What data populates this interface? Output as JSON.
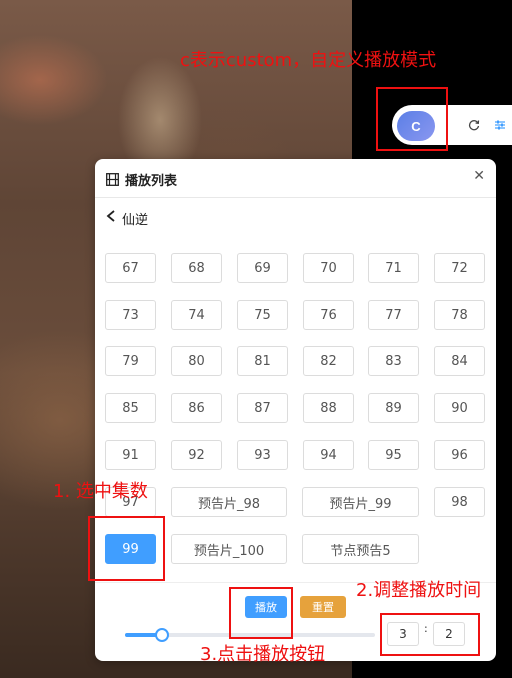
{
  "panel": {
    "title": "播放列表",
    "series_name": "仙逆",
    "episodes_row1": [
      "67",
      "68",
      "69",
      "70",
      "71",
      "72"
    ],
    "episodes_row2": [
      "73",
      "74",
      "75",
      "76",
      "77",
      "78"
    ],
    "episodes_row3": [
      "79",
      "80",
      "81",
      "82",
      "83",
      "84"
    ],
    "episodes_row4": [
      "85",
      "86",
      "87",
      "88",
      "89",
      "90"
    ],
    "episodes_row5": [
      "91",
      "92",
      "93",
      "94",
      "95",
      "96"
    ],
    "episodes_row6": [
      "97",
      "预告片_98",
      "预告片_99",
      "98"
    ],
    "episodes_row7": [
      "99",
      "预告片_100",
      "节点预告5"
    ],
    "selected_episode": "99",
    "play_label": "播放",
    "reset_label": "重置",
    "time_minutes": "3",
    "time_seconds": "2",
    "time_separator": ":",
    "slider_fraction": 0.14
  },
  "toolbar": {
    "mode_label": "C"
  },
  "icons": {
    "close": "close-icon",
    "back": "chevron-left-icon",
    "film": "film-icon",
    "refresh": "refresh-icon",
    "settings": "sliders-icon"
  },
  "annotations": {
    "custom_mode": "c表示custom，自定义播放模式",
    "select_episode": "1. 选中集数",
    "adjust_time": "2.调整播放时间",
    "click_play": "3.点击播放按钮"
  },
  "colors": {
    "accent": "#409eff",
    "warning": "#e6a23c",
    "annotation": "#ee1111"
  }
}
